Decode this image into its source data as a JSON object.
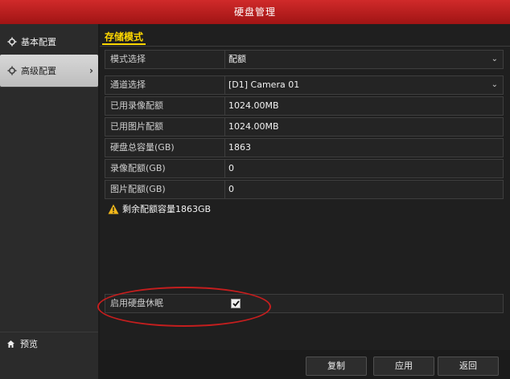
{
  "window": {
    "title": "硬盘管理"
  },
  "sidebar": {
    "items": [
      {
        "label": "基本配置",
        "icon": "gear-icon"
      },
      {
        "label": "高级配置",
        "icon": "gear-icon"
      }
    ],
    "preview_label": "预览"
  },
  "tab": {
    "label": "存储模式"
  },
  "mode": {
    "label": "模式选择",
    "value": "配额"
  },
  "fields": [
    {
      "label": "通道选择",
      "value": "[D1] Camera 01"
    },
    {
      "label": "已用录像配额",
      "value": "1024.00MB"
    },
    {
      "label": "已用图片配额",
      "value": "1024.00MB"
    },
    {
      "label": "硬盘总容量(GB)",
      "value": "1863"
    },
    {
      "label": "录像配额(GB)",
      "value": "0"
    },
    {
      "label": "图片配额(GB)",
      "value": "0"
    }
  ],
  "warning": {
    "text": "剩余配额容量1863GB"
  },
  "sleep": {
    "label": "启用硬盘休眠",
    "checked": true
  },
  "buttons": {
    "copy": "复制",
    "apply": "应用",
    "back": "返回"
  },
  "colors": {
    "title_bar": "#c01e1e",
    "tab_accent": "#ffd800",
    "highlight_ellipse": "#c41e1e"
  }
}
